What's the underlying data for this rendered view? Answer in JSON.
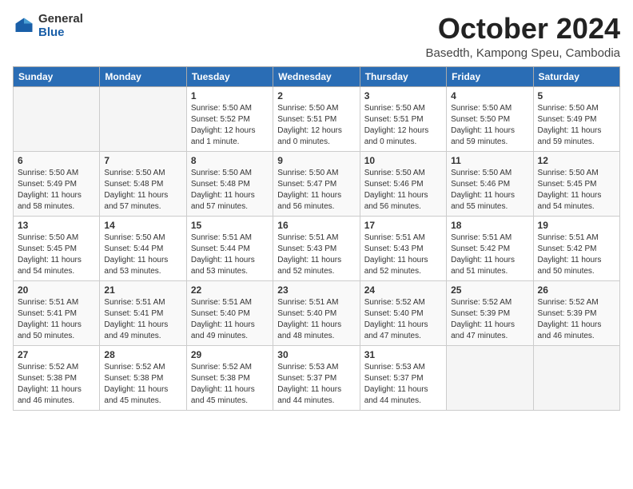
{
  "logo": {
    "general": "General",
    "blue": "Blue"
  },
  "header": {
    "month": "October 2024",
    "location": "Basedth, Kampong Speu, Cambodia"
  },
  "days_of_week": [
    "Sunday",
    "Monday",
    "Tuesday",
    "Wednesday",
    "Thursday",
    "Friday",
    "Saturday"
  ],
  "weeks": [
    [
      {
        "day": "",
        "sunrise": "",
        "sunset": "",
        "daylight": ""
      },
      {
        "day": "",
        "sunrise": "",
        "sunset": "",
        "daylight": ""
      },
      {
        "day": "1",
        "sunrise": "Sunrise: 5:50 AM",
        "sunset": "Sunset: 5:52 PM",
        "daylight": "Daylight: 12 hours and 1 minute."
      },
      {
        "day": "2",
        "sunrise": "Sunrise: 5:50 AM",
        "sunset": "Sunset: 5:51 PM",
        "daylight": "Daylight: 12 hours and 0 minutes."
      },
      {
        "day": "3",
        "sunrise": "Sunrise: 5:50 AM",
        "sunset": "Sunset: 5:51 PM",
        "daylight": "Daylight: 12 hours and 0 minutes."
      },
      {
        "day": "4",
        "sunrise": "Sunrise: 5:50 AM",
        "sunset": "Sunset: 5:50 PM",
        "daylight": "Daylight: 11 hours and 59 minutes."
      },
      {
        "day": "5",
        "sunrise": "Sunrise: 5:50 AM",
        "sunset": "Sunset: 5:49 PM",
        "daylight": "Daylight: 11 hours and 59 minutes."
      }
    ],
    [
      {
        "day": "6",
        "sunrise": "Sunrise: 5:50 AM",
        "sunset": "Sunset: 5:49 PM",
        "daylight": "Daylight: 11 hours and 58 minutes."
      },
      {
        "day": "7",
        "sunrise": "Sunrise: 5:50 AM",
        "sunset": "Sunset: 5:48 PM",
        "daylight": "Daylight: 11 hours and 57 minutes."
      },
      {
        "day": "8",
        "sunrise": "Sunrise: 5:50 AM",
        "sunset": "Sunset: 5:48 PM",
        "daylight": "Daylight: 11 hours and 57 minutes."
      },
      {
        "day": "9",
        "sunrise": "Sunrise: 5:50 AM",
        "sunset": "Sunset: 5:47 PM",
        "daylight": "Daylight: 11 hours and 56 minutes."
      },
      {
        "day": "10",
        "sunrise": "Sunrise: 5:50 AM",
        "sunset": "Sunset: 5:46 PM",
        "daylight": "Daylight: 11 hours and 56 minutes."
      },
      {
        "day": "11",
        "sunrise": "Sunrise: 5:50 AM",
        "sunset": "Sunset: 5:46 PM",
        "daylight": "Daylight: 11 hours and 55 minutes."
      },
      {
        "day": "12",
        "sunrise": "Sunrise: 5:50 AM",
        "sunset": "Sunset: 5:45 PM",
        "daylight": "Daylight: 11 hours and 54 minutes."
      }
    ],
    [
      {
        "day": "13",
        "sunrise": "Sunrise: 5:50 AM",
        "sunset": "Sunset: 5:45 PM",
        "daylight": "Daylight: 11 hours and 54 minutes."
      },
      {
        "day": "14",
        "sunrise": "Sunrise: 5:50 AM",
        "sunset": "Sunset: 5:44 PM",
        "daylight": "Daylight: 11 hours and 53 minutes."
      },
      {
        "day": "15",
        "sunrise": "Sunrise: 5:51 AM",
        "sunset": "Sunset: 5:44 PM",
        "daylight": "Daylight: 11 hours and 53 minutes."
      },
      {
        "day": "16",
        "sunrise": "Sunrise: 5:51 AM",
        "sunset": "Sunset: 5:43 PM",
        "daylight": "Daylight: 11 hours and 52 minutes."
      },
      {
        "day": "17",
        "sunrise": "Sunrise: 5:51 AM",
        "sunset": "Sunset: 5:43 PM",
        "daylight": "Daylight: 11 hours and 52 minutes."
      },
      {
        "day": "18",
        "sunrise": "Sunrise: 5:51 AM",
        "sunset": "Sunset: 5:42 PM",
        "daylight": "Daylight: 11 hours and 51 minutes."
      },
      {
        "day": "19",
        "sunrise": "Sunrise: 5:51 AM",
        "sunset": "Sunset: 5:42 PM",
        "daylight": "Daylight: 11 hours and 50 minutes."
      }
    ],
    [
      {
        "day": "20",
        "sunrise": "Sunrise: 5:51 AM",
        "sunset": "Sunset: 5:41 PM",
        "daylight": "Daylight: 11 hours and 50 minutes."
      },
      {
        "day": "21",
        "sunrise": "Sunrise: 5:51 AM",
        "sunset": "Sunset: 5:41 PM",
        "daylight": "Daylight: 11 hours and 49 minutes."
      },
      {
        "day": "22",
        "sunrise": "Sunrise: 5:51 AM",
        "sunset": "Sunset: 5:40 PM",
        "daylight": "Daylight: 11 hours and 49 minutes."
      },
      {
        "day": "23",
        "sunrise": "Sunrise: 5:51 AM",
        "sunset": "Sunset: 5:40 PM",
        "daylight": "Daylight: 11 hours and 48 minutes."
      },
      {
        "day": "24",
        "sunrise": "Sunrise: 5:52 AM",
        "sunset": "Sunset: 5:40 PM",
        "daylight": "Daylight: 11 hours and 47 minutes."
      },
      {
        "day": "25",
        "sunrise": "Sunrise: 5:52 AM",
        "sunset": "Sunset: 5:39 PM",
        "daylight": "Daylight: 11 hours and 47 minutes."
      },
      {
        "day": "26",
        "sunrise": "Sunrise: 5:52 AM",
        "sunset": "Sunset: 5:39 PM",
        "daylight": "Daylight: 11 hours and 46 minutes."
      }
    ],
    [
      {
        "day": "27",
        "sunrise": "Sunrise: 5:52 AM",
        "sunset": "Sunset: 5:38 PM",
        "daylight": "Daylight: 11 hours and 46 minutes."
      },
      {
        "day": "28",
        "sunrise": "Sunrise: 5:52 AM",
        "sunset": "Sunset: 5:38 PM",
        "daylight": "Daylight: 11 hours and 45 minutes."
      },
      {
        "day": "29",
        "sunrise": "Sunrise: 5:52 AM",
        "sunset": "Sunset: 5:38 PM",
        "daylight": "Daylight: 11 hours and 45 minutes."
      },
      {
        "day": "30",
        "sunrise": "Sunrise: 5:53 AM",
        "sunset": "Sunset: 5:37 PM",
        "daylight": "Daylight: 11 hours and 44 minutes."
      },
      {
        "day": "31",
        "sunrise": "Sunrise: 5:53 AM",
        "sunset": "Sunset: 5:37 PM",
        "daylight": "Daylight: 11 hours and 44 minutes."
      },
      {
        "day": "",
        "sunrise": "",
        "sunset": "",
        "daylight": ""
      },
      {
        "day": "",
        "sunrise": "",
        "sunset": "",
        "daylight": ""
      }
    ]
  ]
}
